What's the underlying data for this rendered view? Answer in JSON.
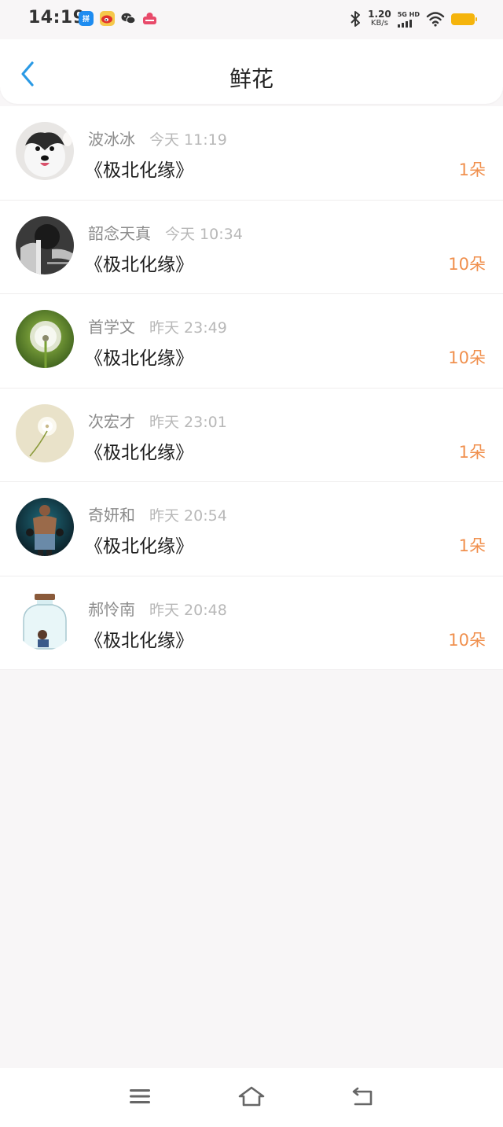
{
  "status_bar": {
    "time": "14:19",
    "speed_value": "1.20",
    "speed_unit": "KB/s",
    "network": "5G HD",
    "app_icons": [
      "pinduoduo-icon",
      "weibo-icon",
      "wechat-icon",
      "app-icon"
    ]
  },
  "header": {
    "title": "鲜花",
    "back_icon": "chevron-left-icon"
  },
  "colors": {
    "accent_blue": "#2b9ae5",
    "count_orange": "#f0904e",
    "battery": "#f5b40c"
  },
  "flower_list": [
    {
      "username": "波冰冰",
      "time": "今天 11:19",
      "book": "《极北化缘》",
      "count": "1朵"
    },
    {
      "username": "韶念天真",
      "time": "今天 10:34",
      "book": "《极北化缘》",
      "count": "10朵"
    },
    {
      "username": "首学文",
      "time": "昨天 23:49",
      "book": "《极北化缘》",
      "count": "10朵"
    },
    {
      "username": "次宏才",
      "time": "昨天 23:01",
      "book": "《极北化缘》",
      "count": "1朵"
    },
    {
      "username": "奇妍和",
      "time": "昨天 20:54",
      "book": "《极北化缘》",
      "count": "1朵"
    },
    {
      "username": "郝怜南",
      "time": "昨天 20:48",
      "book": "《极北化缘》",
      "count": "10朵"
    }
  ],
  "nav_bar": {
    "items": [
      "menu-icon",
      "home-icon",
      "back-icon"
    ]
  }
}
